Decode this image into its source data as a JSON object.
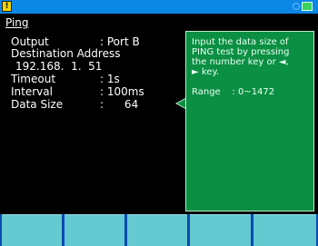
{
  "status_bar": {
    "warning_icon": "!",
    "icons": [
      "circle-status-icon",
      "green-status-icon"
    ]
  },
  "screen": {
    "title": "Ping"
  },
  "fields": [
    {
      "label": "Output",
      "value": ": Port B"
    },
    {
      "label": "Destination Address",
      "value": ""
    },
    {
      "label": "192.168.  1.  51",
      "value": ""
    },
    {
      "label": "Timeout",
      "value": ": 1s"
    },
    {
      "label": "Interval",
      "value": ": 100ms"
    },
    {
      "label": "Data Size",
      "value": ":      64"
    }
  ],
  "help": {
    "text": "Input the data size of\nPING test by pressing\nthe number key or ◄,\n► key.",
    "range": "Range    : 0~1472"
  },
  "softkeys": [
    "",
    "",
    "",
    "",
    ""
  ]
}
